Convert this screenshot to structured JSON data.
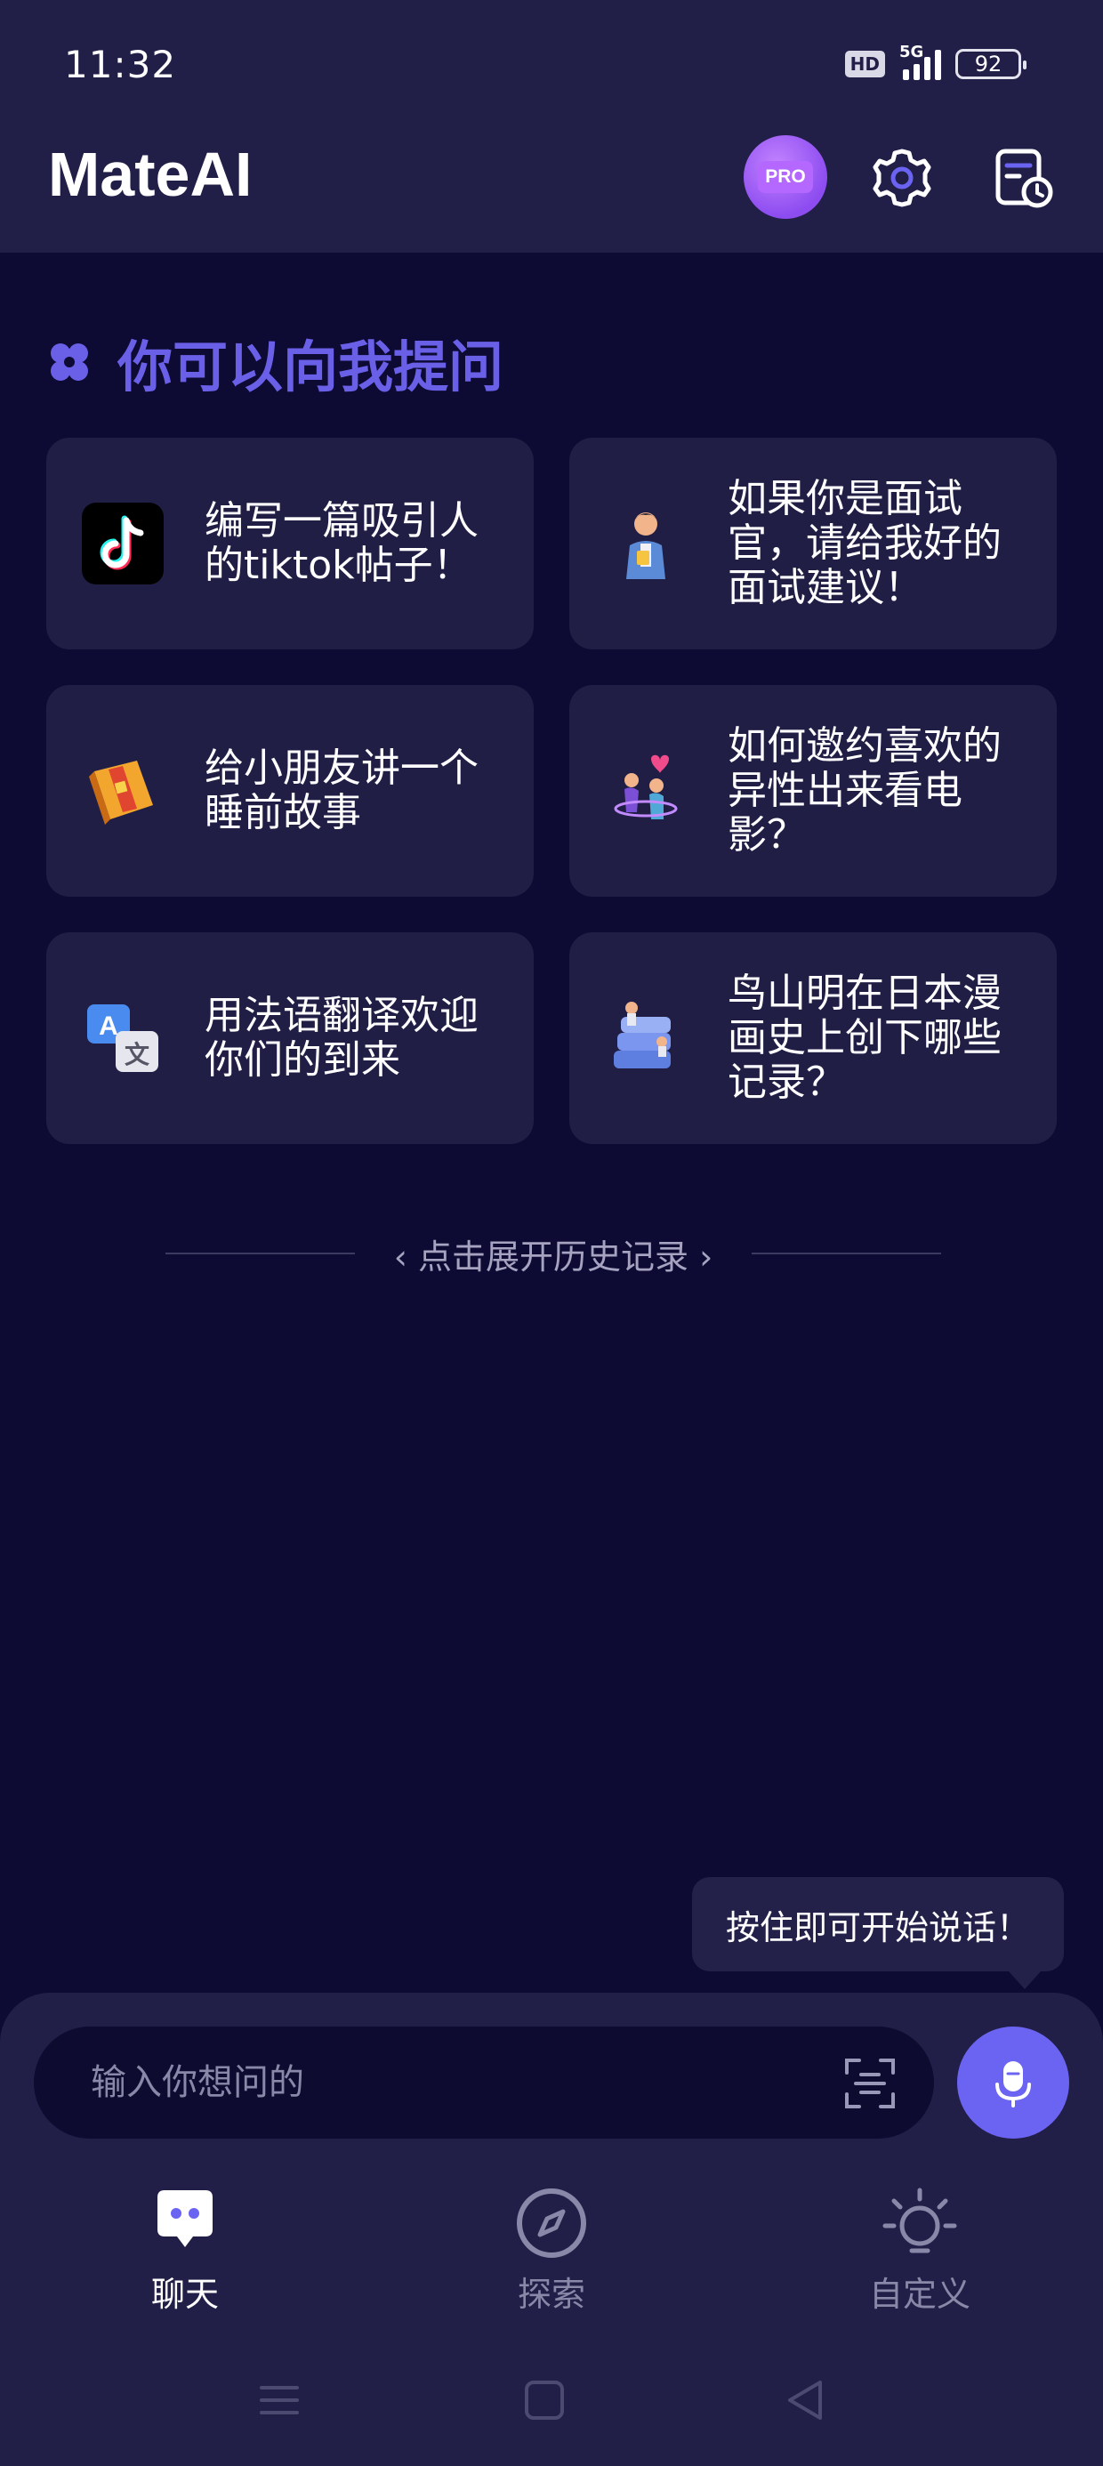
{
  "status_bar": {
    "time": "11:32",
    "hd": "HD",
    "network": "5G",
    "battery": "92"
  },
  "header": {
    "app_title": "MateAI",
    "pro_label": "PRO"
  },
  "prompts_section": {
    "title": "你可以向我提问",
    "cards": [
      {
        "icon": "tiktok-icon",
        "text": "编写一篇吸引人的tiktok帖子！"
      },
      {
        "icon": "interviewer-icon",
        "text": "如果你是面试官，请给我好的面试建议！"
      },
      {
        "icon": "storybook-icon",
        "text": "给小朋友讲一个睡前故事"
      },
      {
        "icon": "couple-icon",
        "text": "如何邀约喜欢的异性出来看电影？"
      },
      {
        "icon": "translate-icon",
        "text": "用法语翻译欢迎你们的到来"
      },
      {
        "icon": "books-icon",
        "text": "鸟山明在日本漫画史上创下哪些记录？"
      }
    ]
  },
  "history": {
    "label": "‹ 点击展开历史记录 ›"
  },
  "tooltip": {
    "text": "按住即可开始说话！"
  },
  "composer": {
    "placeholder": "输入你想问的"
  },
  "bottom_nav": {
    "items": [
      {
        "label": "聊天",
        "icon": "chat-bot-icon",
        "active": true
      },
      {
        "label": "探索",
        "icon": "compass-icon",
        "active": false
      },
      {
        "label": "自定义",
        "icon": "lightbulb-icon",
        "active": false
      }
    ]
  },
  "colors": {
    "background": "#0d0a33",
    "panel": "#211f47",
    "card": "#201e45",
    "accent": "#6b64f2",
    "heading": "#6a60e8"
  }
}
